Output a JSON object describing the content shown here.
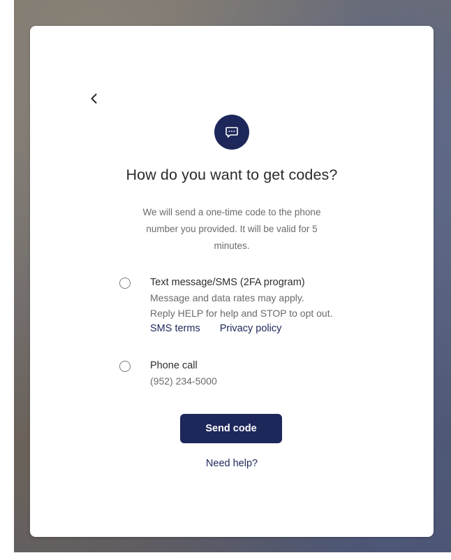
{
  "page": {
    "title": "How do you want to get codes?",
    "description": "We will send a one-time code to the phone number you provided. It will be valid for 5 minutes.",
    "icon": "chat-icon",
    "back_icon": "chevron-left-icon"
  },
  "options": [
    {
      "title": "Text message/SMS (2FA program)",
      "lines": [
        "Message and data rates may apply.",
        "Reply HELP for help and STOP to opt out."
      ],
      "links": [
        "SMS terms",
        "Privacy policy"
      ],
      "selected": false
    },
    {
      "title": "Phone call",
      "lines": [
        "(952) 234-5000"
      ],
      "selected": false
    }
  ],
  "actions": {
    "send_label": "Send code",
    "help_label": "Need help?"
  },
  "colors": {
    "primary": "#1d275a",
    "text": "#2a2a2a",
    "muted": "#6b6b6b",
    "card": "#ffffff"
  }
}
